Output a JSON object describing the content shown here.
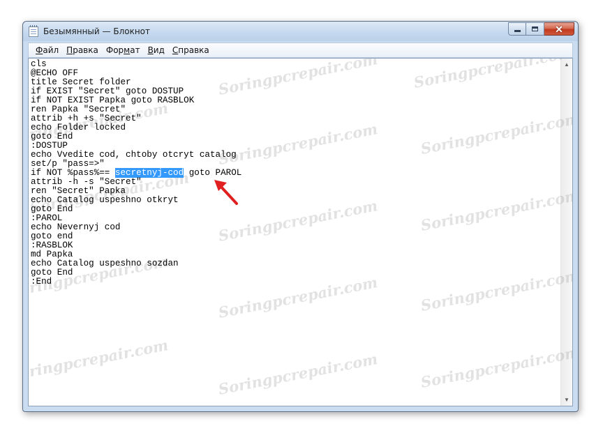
{
  "window": {
    "title": "Безымянный — Блокнот",
    "controls": {
      "minimize": "minimize",
      "maximize": "maximize",
      "close": "✕"
    }
  },
  "menu": {
    "items": [
      {
        "accel": "Ф",
        "rest": "айл"
      },
      {
        "accel": "П",
        "rest": "равка"
      },
      {
        "accel": "",
        "rest": "Формат",
        "accel_inner": true
      },
      {
        "accel": "В",
        "rest": "ид"
      },
      {
        "accel": "С",
        "rest": "правка"
      }
    ],
    "format_pre": "Фор",
    "format_u": "м",
    "format_post": "ат"
  },
  "editor": {
    "lines": [
      "cls",
      "@ECHO OFF",
      "title Secret folder",
      "if EXIST \"Secret\" goto DOSTUP",
      "if NOT EXIST Papka goto RASBLOK",
      "ren Papka \"Secret\"",
      "attrib +h +s \"Secret\"",
      "echo Folder locked",
      "goto End",
      ":DOSTUP",
      "echo Vvedite cod, chtoby otcryt catalog",
      "set/p \"pass=>\"",
      "if NOT %pass%== ",
      "attrib -h -s \"Secret\"",
      "ren \"Secret\" Papka",
      "echo Catalog uspeshno otkryt",
      "goto End",
      ":PAROL",
      "echo Nevernyj cod",
      "goto end",
      ":RASBLOK",
      "md Papka",
      "echo Catalog uspeshno sozdan",
      "goto End",
      ":End"
    ],
    "selected_text": "secretnyj-cod",
    "after_selection": " goto PAROL"
  },
  "watermark_text": "Soringpcrepair.com",
  "colors": {
    "selection": "#3399ff",
    "arrow": "#e02020",
    "close_button": "#c2391d"
  },
  "icons": {
    "app": "notepad-icon",
    "annotation": "red-arrow-icon"
  }
}
